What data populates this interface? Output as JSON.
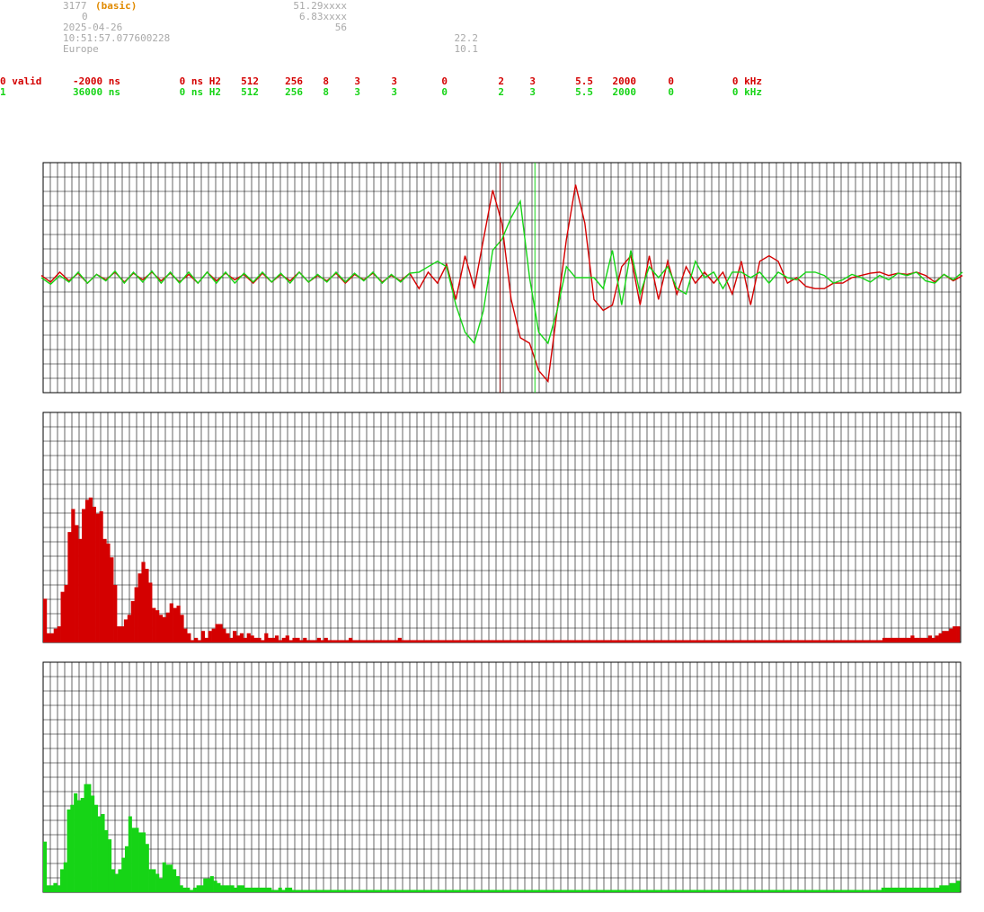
{
  "header": {
    "station_id": "3177",
    "mode": "(basic)",
    "field_0": "0",
    "date": "2025-04-26",
    "time": "10:51:57.077600228",
    "region": "Europe",
    "lat": "51.29xxxx",
    "lon": "6.83xxxx",
    "value_56": "56",
    "value_22": "22.2",
    "value_10": "10.1"
  },
  "channels": [
    {
      "label": "0 valid",
      "offset": "-2000 ns",
      "delay": "0 ns H2",
      "c1": "512",
      "c2": "256",
      "c3": "8",
      "c4": "3",
      "c5": "3",
      "c6": "0",
      "c7": "2",
      "c8": "3",
      "c9": "5.5",
      "c10": "2000",
      "c11": "0",
      "freq": "0 kHz",
      "color": "#d40000"
    },
    {
      "label": "1",
      "offset": "36000 ns",
      "delay": "0 ns H2",
      "c1": "512",
      "c2": "256",
      "c3": "8",
      "c4": "3",
      "c5": "3",
      "c6": "0",
      "c7": "2",
      "c8": "3",
      "c9": "5.5",
      "c10": "2000",
      "c11": "0",
      "freq": "0 kHz",
      "color": "#16d416"
    }
  ],
  "chart_data": [
    {
      "type": "line",
      "name": "waveform",
      "ylim": [
        -1,
        1
      ],
      "grid": true,
      "x": [
        0,
        0.01,
        0.02,
        0.03,
        0.04,
        0.05,
        0.06,
        0.07,
        0.08,
        0.09,
        0.1,
        0.11,
        0.12,
        0.13,
        0.14,
        0.15,
        0.16,
        0.17,
        0.18,
        0.19,
        0.2,
        0.21,
        0.22,
        0.23,
        0.24,
        0.25,
        0.26,
        0.27,
        0.28,
        0.29,
        0.3,
        0.31,
        0.32,
        0.33,
        0.34,
        0.35,
        0.36,
        0.37,
        0.38,
        0.39,
        0.4,
        0.41,
        0.42,
        0.43,
        0.44,
        0.45,
        0.46,
        0.47,
        0.48,
        0.49,
        0.5,
        0.51,
        0.52,
        0.53,
        0.54,
        0.55,
        0.56,
        0.57,
        0.58,
        0.59,
        0.6,
        0.61,
        0.62,
        0.63,
        0.64,
        0.65,
        0.66,
        0.67,
        0.68,
        0.69,
        0.7,
        0.71,
        0.72,
        0.73,
        0.74,
        0.75,
        0.76,
        0.77,
        0.78,
        0.79,
        0.8,
        0.81,
        0.82,
        0.83,
        0.84,
        0.85,
        0.86,
        0.87,
        0.88,
        0.89,
        0.9,
        0.91,
        0.92,
        0.93,
        0.94,
        0.95,
        0.96,
        0.97,
        0.98,
        0.99,
        1.0
      ],
      "series": [
        {
          "color": "#d40000",
          "values": [
            0.02,
            -0.04,
            0.05,
            -0.03,
            0.04,
            -0.05,
            0.03,
            -0.02,
            0.05,
            -0.04,
            0.04,
            -0.02,
            0.05,
            -0.03,
            0.04,
            -0.04,
            0.03,
            -0.05,
            0.05,
            -0.03,
            0.04,
            -0.02,
            0.03,
            -0.05,
            0.04,
            -0.04,
            0.03,
            -0.03,
            0.05,
            -0.04,
            0.02,
            -0.03,
            0.04,
            -0.05,
            0.03,
            -0.02,
            0.04,
            -0.04,
            0.02,
            -0.03,
            0.04,
            -0.1,
            0.05,
            -0.05,
            0.12,
            -0.2,
            0.2,
            -0.1,
            0.35,
            0.8,
            0.5,
            -0.2,
            -0.55,
            -0.6,
            -0.85,
            -0.95,
            -0.3,
            0.35,
            0.85,
            0.5,
            -0.2,
            -0.3,
            -0.25,
            0.1,
            0.2,
            -0.25,
            0.2,
            -0.2,
            0.15,
            -0.15,
            0.1,
            -0.05,
            0.05,
            -0.05,
            0.05,
            -0.15,
            0.15,
            -0.25,
            0.15,
            0.2,
            0.15,
            -0.05,
            0.0,
            -0.08,
            -0.1,
            -0.1,
            -0.05,
            -0.05,
            0.0,
            0.02,
            0.04,
            0.05,
            0.02,
            0.04,
            0.03,
            0.05,
            0.02,
            -0.04,
            0.03,
            -0.03,
            0.02
          ]
        },
        {
          "color": "#16d416",
          "values": [
            0.0,
            -0.06,
            0.02,
            -0.04,
            0.05,
            -0.05,
            0.03,
            -0.03,
            0.06,
            -0.05,
            0.05,
            -0.04,
            0.06,
            -0.05,
            0.05,
            -0.05,
            0.05,
            -0.05,
            0.05,
            -0.05,
            0.05,
            -0.05,
            0.04,
            -0.04,
            0.05,
            -0.04,
            0.04,
            -0.05,
            0.05,
            -0.04,
            0.03,
            -0.04,
            0.05,
            -0.04,
            0.04,
            -0.03,
            0.05,
            -0.05,
            0.03,
            -0.04,
            0.04,
            0.05,
            0.1,
            0.15,
            0.1,
            -0.25,
            -0.5,
            -0.6,
            -0.3,
            0.25,
            0.35,
            0.55,
            0.7,
            0.0,
            -0.5,
            -0.6,
            -0.3,
            0.1,
            0.0,
            0.0,
            0.0,
            -0.1,
            0.25,
            -0.25,
            0.25,
            -0.15,
            0.1,
            0.0,
            0.1,
            -0.1,
            -0.15,
            0.15,
            0.0,
            0.05,
            -0.1,
            0.05,
            0.05,
            0.0,
            0.05,
            -0.05,
            0.05,
            0.0,
            -0.02,
            0.05,
            0.05,
            0.02,
            -0.05,
            -0.02,
            0.03,
            0.0,
            -0.04,
            0.02,
            -0.02,
            0.04,
            0.02,
            0.05,
            -0.03,
            -0.05,
            0.03,
            -0.02,
            0.05
          ]
        }
      ],
      "markers": [
        {
          "x": 0.498,
          "color": "#8b0000"
        },
        {
          "x": 0.536,
          "color": "#16d416"
        }
      ]
    },
    {
      "type": "bar",
      "name": "spectrum-0",
      "color": "#d40000",
      "ylim": [
        0,
        1
      ],
      "grid": true,
      "values": [
        0.19,
        0.04,
        0.04,
        0.06,
        0.07,
        0.22,
        0.25,
        0.48,
        0.58,
        0.51,
        0.45,
        0.58,
        0.62,
        0.63,
        0.59,
        0.56,
        0.57,
        0.45,
        0.43,
        0.37,
        0.25,
        0.07,
        0.07,
        0.1,
        0.12,
        0.18,
        0.24,
        0.3,
        0.35,
        0.32,
        0.26,
        0.15,
        0.14,
        0.12,
        0.11,
        0.13,
        0.17,
        0.15,
        0.16,
        0.12,
        0.06,
        0.04,
        0.01,
        0.02,
        0.01,
        0.05,
        0.02,
        0.05,
        0.06,
        0.08,
        0.08,
        0.06,
        0.04,
        0.02,
        0.05,
        0.03,
        0.04,
        0.02,
        0.04,
        0.03,
        0.02,
        0.02,
        0.01,
        0.04,
        0.02,
        0.02,
        0.03,
        0.01,
        0.02,
        0.03,
        0.01,
        0.02,
        0.02,
        0.01,
        0.02,
        0.01,
        0.01,
        0.01,
        0.02,
        0.01,
        0.02,
        0.01,
        0.01,
        0.01,
        0.01,
        0.01,
        0.01,
        0.02,
        0.01,
        0.01,
        0.01,
        0.01,
        0.01,
        0.01,
        0.01,
        0.01,
        0.01,
        0.01,
        0.01,
        0.01,
        0.01,
        0.02,
        0.01,
        0.01,
        0.01,
        0.01,
        0.01,
        0.01,
        0.01,
        0.01,
        0.01,
        0.01,
        0.01,
        0.01,
        0.01,
        0.01,
        0.01,
        0.01,
        0.01,
        0.01,
        0.01,
        0.01,
        0.01,
        0.01,
        0.01,
        0.01,
        0.01,
        0.01,
        0.01,
        0.01,
        0.01,
        0.01,
        0.01,
        0.01,
        0.01,
        0.01,
        0.01,
        0.01,
        0.01,
        0.01,
        0.01,
        0.01,
        0.01,
        0.01,
        0.01,
        0.01,
        0.01,
        0.01,
        0.01,
        0.01,
        0.01,
        0.01,
        0.01,
        0.01,
        0.01,
        0.01,
        0.01,
        0.01,
        0.01,
        0.01,
        0.01,
        0.01,
        0.01,
        0.01,
        0.01,
        0.01,
        0.01,
        0.01,
        0.01,
        0.01,
        0.01,
        0.01,
        0.01,
        0.01,
        0.01,
        0.01,
        0.01,
        0.01,
        0.01,
        0.01,
        0.01,
        0.01,
        0.01,
        0.01,
        0.01,
        0.01,
        0.01,
        0.01,
        0.01,
        0.01,
        0.01,
        0.01,
        0.01,
        0.01,
        0.01,
        0.01,
        0.01,
        0.01,
        0.01,
        0.01,
        0.01,
        0.01,
        0.01,
        0.01,
        0.01,
        0.01,
        0.01,
        0.01,
        0.01,
        0.01,
        0.01,
        0.01,
        0.01,
        0.01,
        0.01,
        0.01,
        0.01,
        0.01,
        0.01,
        0.01,
        0.01,
        0.01,
        0.01,
        0.01,
        0.01,
        0.01,
        0.01,
        0.01,
        0.01,
        0.01,
        0.01,
        0.01,
        0.01,
        0.01,
        0.01,
        0.01,
        0.01,
        0.01,
        0.01,
        0.02,
        0.02,
        0.02,
        0.02,
        0.02,
        0.02,
        0.02,
        0.02,
        0.03,
        0.02,
        0.02,
        0.02,
        0.02,
        0.03,
        0.02,
        0.03,
        0.04,
        0.05,
        0.05,
        0.06,
        0.07,
        0.07
      ]
    },
    {
      "type": "bar",
      "name": "spectrum-1",
      "color": "#16d416",
      "ylim": [
        0,
        1
      ],
      "grid": true,
      "values": [
        0.22,
        0.03,
        0.03,
        0.04,
        0.03,
        0.1,
        0.13,
        0.36,
        0.38,
        0.43,
        0.4,
        0.41,
        0.47,
        0.47,
        0.42,
        0.38,
        0.33,
        0.34,
        0.27,
        0.23,
        0.1,
        0.08,
        0.1,
        0.15,
        0.2,
        0.33,
        0.28,
        0.28,
        0.26,
        0.26,
        0.21,
        0.1,
        0.1,
        0.08,
        0.06,
        0.13,
        0.12,
        0.12,
        0.1,
        0.07,
        0.03,
        0.02,
        0.02,
        0.01,
        0.02,
        0.03,
        0.03,
        0.06,
        0.06,
        0.07,
        0.05,
        0.04,
        0.03,
        0.03,
        0.03,
        0.03,
        0.02,
        0.03,
        0.03,
        0.02,
        0.02,
        0.02,
        0.02,
        0.02,
        0.02,
        0.02,
        0.02,
        0.01,
        0.01,
        0.02,
        0.01,
        0.02,
        0.02,
        0.01,
        0.01,
        0.01,
        0.01,
        0.01,
        0.01,
        0.01,
        0.01,
        0.01,
        0.01,
        0.01,
        0.01,
        0.01,
        0.01,
        0.01,
        0.01,
        0.01,
        0.01,
        0.01,
        0.01,
        0.01,
        0.01,
        0.01,
        0.01,
        0.01,
        0.01,
        0.01,
        0.01,
        0.01,
        0.01,
        0.01,
        0.01,
        0.01,
        0.01,
        0.01,
        0.01,
        0.01,
        0.01,
        0.01,
        0.01,
        0.01,
        0.01,
        0.01,
        0.01,
        0.01,
        0.01,
        0.01,
        0.01,
        0.01,
        0.01,
        0.01,
        0.01,
        0.01,
        0.01,
        0.01,
        0.01,
        0.01,
        0.01,
        0.01,
        0.01,
        0.01,
        0.01,
        0.01,
        0.01,
        0.01,
        0.01,
        0.01,
        0.01,
        0.01,
        0.01,
        0.01,
        0.01,
        0.01,
        0.01,
        0.01,
        0.01,
        0.01,
        0.01,
        0.01,
        0.01,
        0.01,
        0.01,
        0.01,
        0.01,
        0.01,
        0.01,
        0.01,
        0.01,
        0.01,
        0.01,
        0.01,
        0.01,
        0.01,
        0.01,
        0.01,
        0.01,
        0.01,
        0.01,
        0.01,
        0.01,
        0.01,
        0.01,
        0.01,
        0.01,
        0.01,
        0.01,
        0.01,
        0.01,
        0.01,
        0.01,
        0.01,
        0.01,
        0.01,
        0.01,
        0.01,
        0.01,
        0.01,
        0.01,
        0.01,
        0.01,
        0.01,
        0.01,
        0.01,
        0.01,
        0.01,
        0.01,
        0.01,
        0.01,
        0.01,
        0.01,
        0.01,
        0.01,
        0.01,
        0.01,
        0.01,
        0.01,
        0.01,
        0.01,
        0.01,
        0.01,
        0.01,
        0.01,
        0.01,
        0.01,
        0.01,
        0.01,
        0.01,
        0.01,
        0.01,
        0.01,
        0.01,
        0.01,
        0.01,
        0.01,
        0.01,
        0.01,
        0.01,
        0.01,
        0.01,
        0.01,
        0.01,
        0.01,
        0.01,
        0.01,
        0.01,
        0.01,
        0.01,
        0.01,
        0.01,
        0.01,
        0.01,
        0.01,
        0.01,
        0.02,
        0.02,
        0.02,
        0.02,
        0.02,
        0.02,
        0.02,
        0.02,
        0.02,
        0.02,
        0.02,
        0.02,
        0.02,
        0.02,
        0.02,
        0.02,
        0.02,
        0.03,
        0.03,
        0.03,
        0.04,
        0.04,
        0.05
      ]
    }
  ]
}
